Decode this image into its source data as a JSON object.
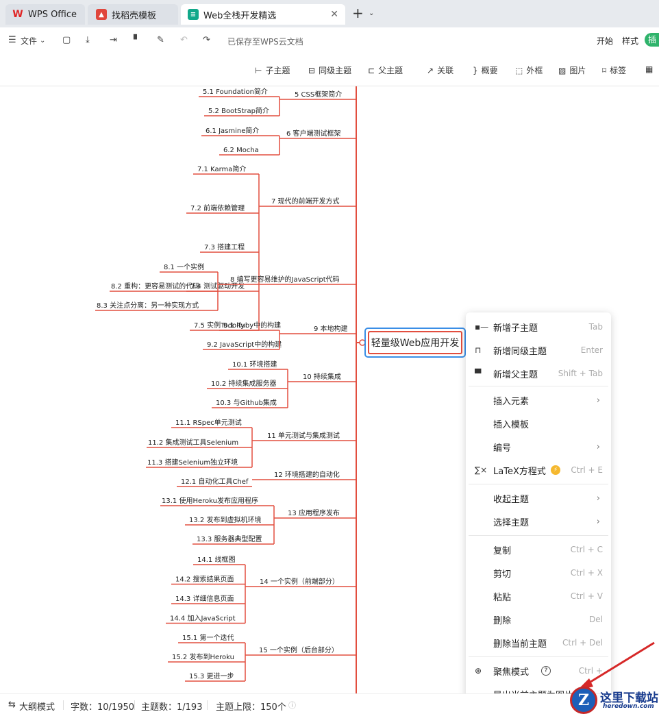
{
  "tabs": [
    {
      "label": "WPS Office",
      "icon": "wps-logo-icon"
    },
    {
      "label": "找稻壳模板",
      "icon": "daoke-icon"
    },
    {
      "label": "Web全栈开发精选",
      "icon": "mindmap-doc-icon"
    }
  ],
  "toolbar": {
    "file_label": "文件",
    "save_status": "已保存至WPS云文档",
    "menu_start": "开始",
    "menu_style": "样式",
    "menu_insert": "插"
  },
  "toolbar2": {
    "subtopic": "子主题",
    "sibling": "同级主题",
    "parent": "父主题",
    "relation": "关联",
    "summary": "概要",
    "frame": "外框",
    "image": "图片",
    "tag": "标签"
  },
  "mindmap": {
    "central": "轻量级Web应用开发",
    "branches": [
      {
        "label": "5 CSS框架简介",
        "children": [
          "5.1 Foundation简介",
          "5.2 BootStrap简介"
        ]
      },
      {
        "label": "6 客户端测试框架",
        "children": [
          "6.1 Jasmine简介",
          "6.2 Mocha"
        ]
      },
      {
        "label": "7 现代的前端开发方式",
        "children": [
          "7.1 Karma简介",
          "7.2 前端依赖管理",
          "7.3 搭建工程",
          "7.4 测试驱动开发",
          "7.5 实例Todoify"
        ]
      },
      {
        "label": "8 编写更容易维护的JavaScript代码",
        "children": [
          "8.1 一个实例",
          "8.2 重构：更容易测试的代码",
          "8.3 关注点分离：另一种实现方式"
        ]
      },
      {
        "label": "9 本地构建",
        "children": [
          "9.1 Ruby中的构建",
          "9.2 JavaScript中的构建"
        ]
      },
      {
        "label": "10 持续集成",
        "children": [
          "10.1 环境搭建",
          "10.2 持续集成服务器",
          "10.3 与Github集成"
        ]
      },
      {
        "label": "11 单元测试与集成测试",
        "children": [
          "11.1 RSpec单元测试",
          "11.2 集成测试工具Selenium",
          "11.3 搭建Selenium独立环境"
        ]
      },
      {
        "label": "12 环境搭建的自动化",
        "children": [
          "12.1 自动化工具Chef"
        ]
      },
      {
        "label": "13 应用程序发布",
        "children": [
          "13.1 使用Heroku发布应用程序",
          "13.2 发布到虚拟机环境",
          "13.3 服务器典型配置"
        ]
      },
      {
        "label": "14 一个实例（前端部分）",
        "children": [
          "14.1 线框图",
          "14.2 搜索结果页面",
          "14.3 详细信息页面",
          "14.4 加入JavaScript"
        ]
      },
      {
        "label": "15 一个实例（后台部分）",
        "children": [
          "15.1 第一个迭代",
          "15.2 发布到Heroku",
          "15.3 更进一步"
        ]
      }
    ]
  },
  "context_menu": {
    "items": [
      {
        "label": "新增子主题",
        "shortcut": "Tab",
        "icon": "add-subtopic-icon"
      },
      {
        "label": "新增同级主题",
        "shortcut": "Enter",
        "icon": "add-sibling-icon"
      },
      {
        "label": "新增父主题",
        "shortcut": "Shift + Tab",
        "icon": "add-parent-icon"
      },
      {
        "label": "插入元素",
        "arrow": "›"
      },
      {
        "label": "插入模板"
      },
      {
        "label": "编号",
        "arrow": "›"
      },
      {
        "label": "LaTeX方程式",
        "shortcut": "Ctrl + E",
        "icon": "formula-icon",
        "badge": "⚡"
      },
      {
        "label": "收起主题",
        "arrow": "›"
      },
      {
        "label": "选择主题",
        "arrow": "›"
      },
      {
        "label": "复制",
        "shortcut": "Ctrl + C"
      },
      {
        "label": "剪切",
        "shortcut": "Ctrl + X"
      },
      {
        "label": "粘贴",
        "shortcut": "Ctrl + V"
      },
      {
        "label": "删除",
        "shortcut": "Del"
      },
      {
        "label": "删除当前主题",
        "shortcut": "Ctrl + Del"
      },
      {
        "label": "聚焦模式",
        "shortcut": "Ctrl +",
        "icon": "focus-icon",
        "help": "?"
      },
      {
        "label": "导出当前主题为图片"
      }
    ]
  },
  "statusbar": {
    "outline_mode": "大纲模式",
    "word_count": "字数：10/1950",
    "topic_count": "主题数：1/193",
    "topic_limit": "主题上限：150个"
  },
  "watermark": {
    "text": "这里下载站",
    "sub": "heredown.com"
  },
  "colors": {
    "branch_line": "#e24e3f",
    "selection": "#3a8ee6",
    "insert_button": "#2fb36b"
  }
}
